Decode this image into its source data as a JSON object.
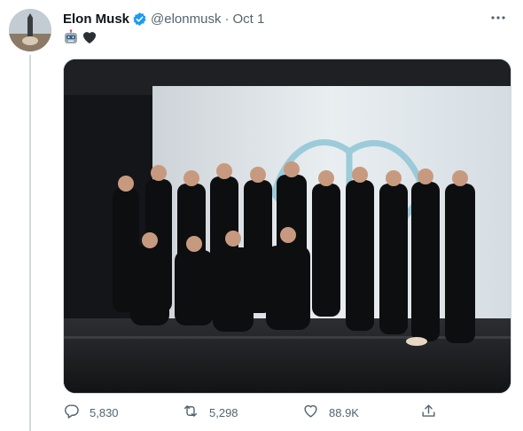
{
  "tweet": {
    "author_name": "Elon Musk",
    "handle": "@elonmusk",
    "separator": "·",
    "date": "Oct 1",
    "emojis": [
      "robot-face-emoji",
      "black-heart-emoji"
    ],
    "verified": true,
    "media_alt": "photo"
  },
  "actions": {
    "replies": "5,830",
    "retweets": "5,298",
    "likes": "88.9K"
  },
  "colors": {
    "text": "#0f1419",
    "secondary": "#536471",
    "verified": "#1d9bf0",
    "border": "#cfd9de"
  },
  "icons": [
    "more-icon",
    "verified-badge-icon",
    "reply-icon",
    "retweet-icon",
    "like-icon",
    "share-icon"
  ]
}
